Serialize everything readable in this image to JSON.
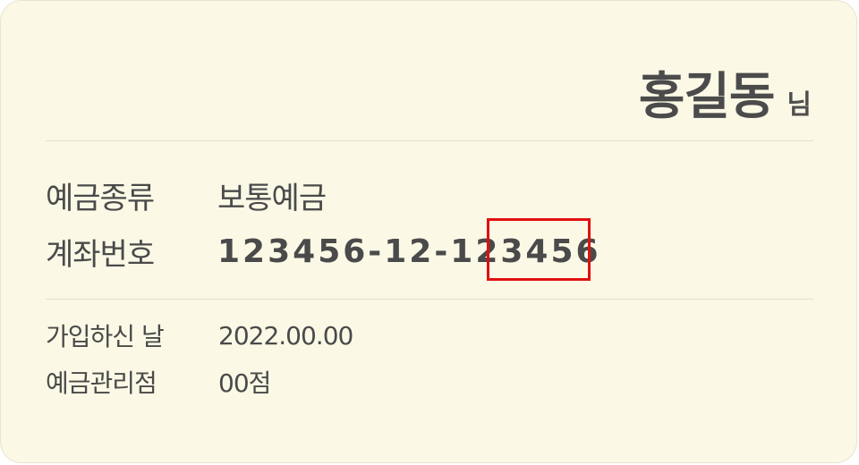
{
  "customer": {
    "name": "홍길동",
    "honorific": "님"
  },
  "account": {
    "type_label": "예금종류",
    "type_value": "보통예금",
    "number_label": "계좌번호",
    "number_value": "123456-12-123456"
  },
  "details": {
    "join_date_label": "가입하신 날",
    "join_date_value": "2022.00.00",
    "branch_label": "예금관리점",
    "branch_value": "00점"
  },
  "colors": {
    "card_background": "#fbf9e6",
    "text": "#4a4a4a",
    "highlight_border": "#e01010"
  }
}
